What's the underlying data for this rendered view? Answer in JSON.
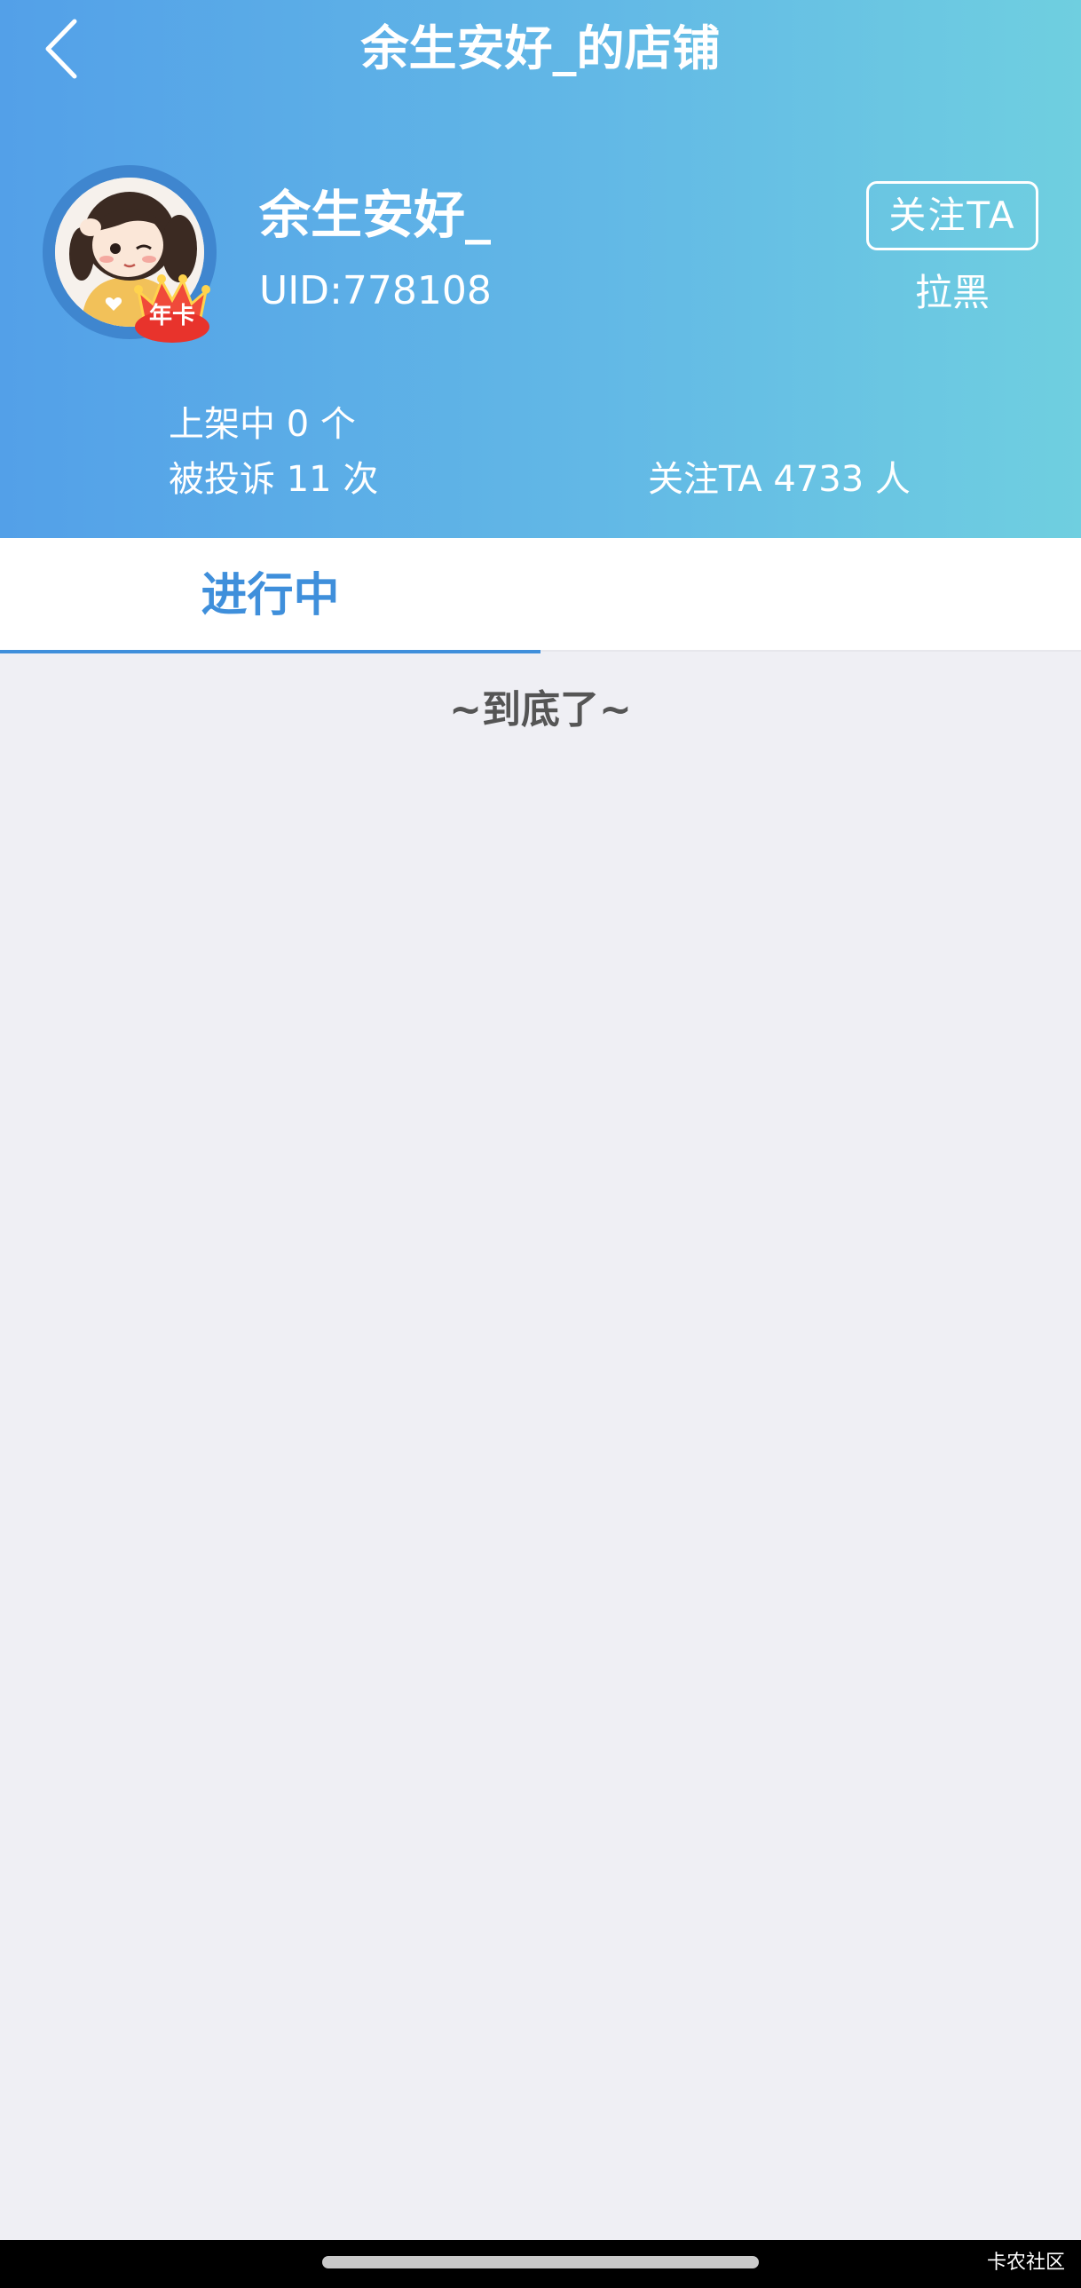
{
  "header": {
    "title": "余生安好_的店铺",
    "back_icon": "chevron-left-icon"
  },
  "profile": {
    "username": "余生安好_",
    "uid": "UID:778108",
    "badge": "年卡",
    "follow_label": "关注TA",
    "block_label": "拉黑"
  },
  "stats": {
    "listed": "上架中 0 个",
    "complaints": "被投诉 11 次",
    "followers": "关注TA 4733 人"
  },
  "tabs": [
    {
      "label": "进行中",
      "active": true
    }
  ],
  "list": {
    "end_text": "~到底了~"
  },
  "system": {
    "watermark": "卡农社区"
  },
  "colors": {
    "accent": "#3f8fdb",
    "header_gradient_start": "#53a0e8",
    "header_gradient_end": "#6fcfe0",
    "background": "#efeff4"
  }
}
